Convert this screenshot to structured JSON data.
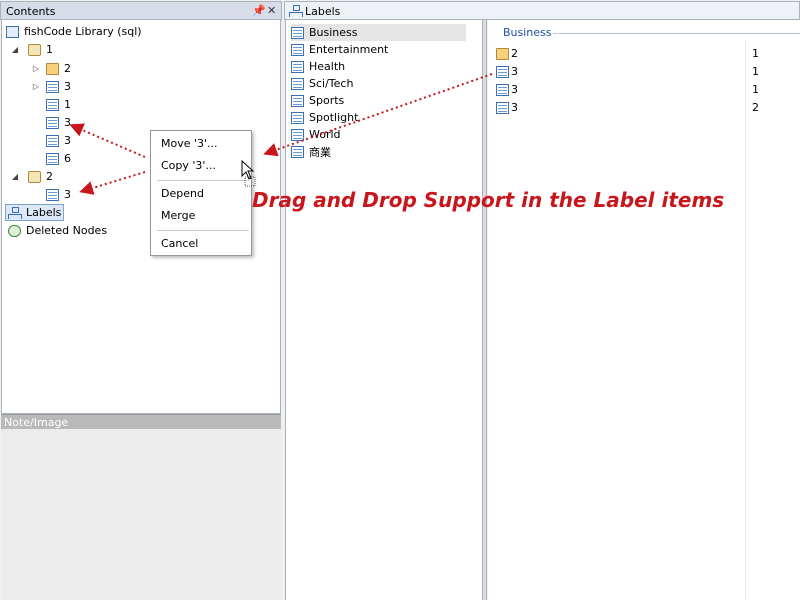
{
  "contents_panel": {
    "title": "Contents",
    "pin_icon": "pin-icon",
    "close_icon": "close-icon",
    "tree": [
      {
        "label": "fishCode Library (sql)",
        "icon": "library-icon"
      },
      {
        "label": "1",
        "icon": "database-icon",
        "expander": "expanded"
      },
      {
        "label": "2",
        "icon": "folder-icon",
        "expander": "collapsed"
      },
      {
        "label": "3",
        "icon": "table-icon",
        "expander": "collapsed"
      },
      {
        "label": "1",
        "icon": "table-icon"
      },
      {
        "label": "3",
        "icon": "table-icon"
      },
      {
        "label": "3",
        "icon": "table-icon"
      },
      {
        "label": "6",
        "icon": "table-icon"
      },
      {
        "label": "2",
        "icon": "database-icon",
        "expander": "expanded"
      },
      {
        "label": "3",
        "icon": "table-icon"
      },
      {
        "label": "Labels",
        "icon": "network-icon",
        "selected": true
      },
      {
        "label": "Deleted Nodes",
        "icon": "recycle-icon"
      }
    ]
  },
  "note_panel": {
    "title": "Note/Image"
  },
  "labels_panel": {
    "title": "Labels",
    "items": [
      "Business",
      "Entertainment",
      "Health",
      "Sci/Tech",
      "Sports",
      "Spotlight",
      "World",
      "商業"
    ],
    "selected": "Business"
  },
  "detail": {
    "group_title": "Business",
    "rows": [
      {
        "name": "2",
        "icon": "folder-icon",
        "value": "1"
      },
      {
        "name": "3",
        "icon": "table-icon",
        "value": "1"
      },
      {
        "name": "3",
        "icon": "table-icon",
        "value": "1"
      },
      {
        "name": "3",
        "icon": "table-icon",
        "value": "2"
      }
    ]
  },
  "context_menu": {
    "move": "Move '3'...",
    "copy": "Copy '3'...",
    "depend": "Depend",
    "merge": "Merge",
    "cancel": "Cancel"
  },
  "annotation": "Drag and Drop Support in the Label items",
  "colors": {
    "annotation": "#c8161d",
    "group_title": "#1f4fa0"
  }
}
